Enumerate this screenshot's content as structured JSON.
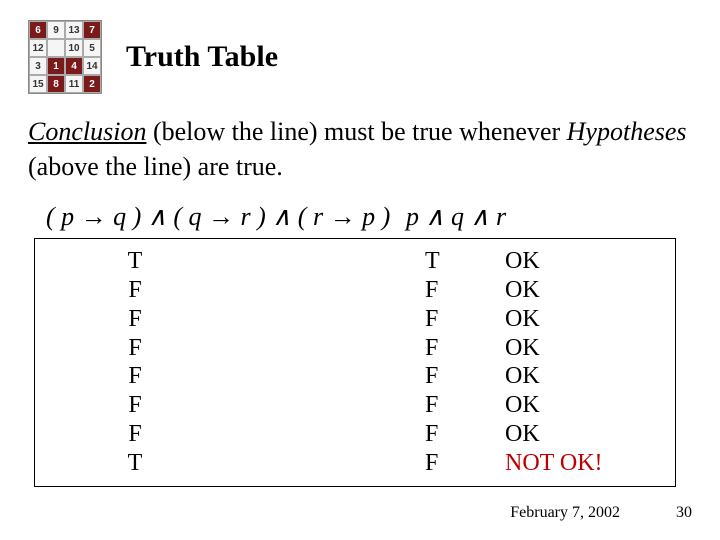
{
  "header": {
    "title": "Truth Table",
    "magic_square": [
      {
        "v": "6",
        "dark": true
      },
      {
        "v": "9",
        "dark": false
      },
      {
        "v": "13",
        "dark": false
      },
      {
        "v": "7",
        "dark": true
      },
      {
        "v": "12",
        "dark": false
      },
      {
        "v": "",
        "dark": false
      },
      {
        "v": "10",
        "dark": false
      },
      {
        "v": "5",
        "dark": false
      },
      {
        "v": "3",
        "dark": false
      },
      {
        "v": "1",
        "dark": true
      },
      {
        "v": "4",
        "dark": true
      },
      {
        "v": "14",
        "dark": false
      },
      {
        "v": "15",
        "dark": false
      },
      {
        "v": "8",
        "dark": true
      },
      {
        "v": "11",
        "dark": false
      },
      {
        "v": "2",
        "dark": true
      }
    ]
  },
  "body": {
    "conclusion_label": "Conclusion",
    "text_mid1": " (below the line) must be true whenever ",
    "hypotheses_label": "Hypotheses",
    "text_mid2": " (above the line) are true."
  },
  "formulas": {
    "left": "( p → q ) ∧ ( q → r ) ∧ ( r → p )",
    "right": "p ∧ q ∧ r"
  },
  "truth_table": {
    "rows": [
      {
        "a": "T",
        "b": "T",
        "res": "OK",
        "bad": false
      },
      {
        "a": "F",
        "b": "F",
        "res": "OK",
        "bad": false
      },
      {
        "a": "F",
        "b": "F",
        "res": "OK",
        "bad": false
      },
      {
        "a": "F",
        "b": "F",
        "res": "OK",
        "bad": false
      },
      {
        "a": "F",
        "b": "F",
        "res": "OK",
        "bad": false
      },
      {
        "a": "F",
        "b": "F",
        "res": "OK",
        "bad": false
      },
      {
        "a": "F",
        "b": "F",
        "res": "OK",
        "bad": false
      },
      {
        "a": "T",
        "b": "F",
        "res": "NOT OK!",
        "bad": true
      }
    ]
  },
  "footer": {
    "date": "February 7, 2002",
    "page": "30"
  }
}
